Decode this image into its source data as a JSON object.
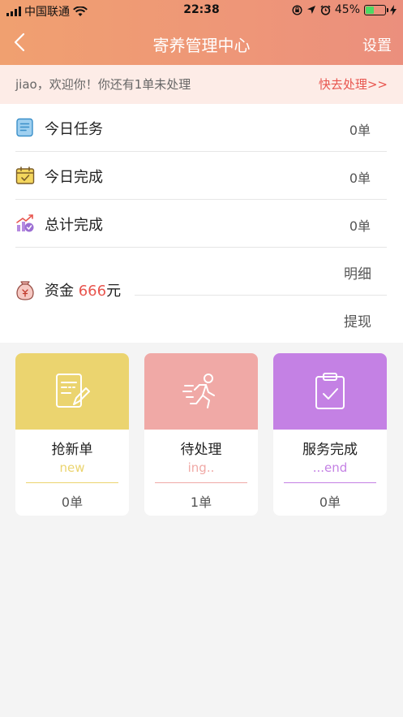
{
  "status_bar": {
    "carrier": "中国联通",
    "time": "22:38",
    "battery_percent": "45%"
  },
  "nav": {
    "title": "寄养管理中心",
    "settings_label": "设置"
  },
  "notice": {
    "message": "jiao，欢迎你！你还有1单未处理",
    "action_label": "快去处理>>"
  },
  "stats": [
    {
      "label": "今日任务",
      "count": "0单",
      "icon": "document-list-icon"
    },
    {
      "label": "今日完成",
      "count": "0单",
      "icon": "calendar-check-icon"
    },
    {
      "label": "总计完成",
      "count": "0单",
      "icon": "growth-chart-icon"
    }
  ],
  "funds": {
    "label": "资金",
    "amount": "666",
    "unit": "元",
    "detail_label": "明细",
    "withdraw_label": "提现",
    "icon": "money-bag-icon"
  },
  "cards": [
    {
      "title": "抢新单",
      "subtitle": "new",
      "count": "0单",
      "color": "#ebd46f",
      "accent": "#ebd46f",
      "icon": "edit-document-icon"
    },
    {
      "title": "待处理",
      "subtitle": "ing..",
      "count": "1单",
      "color": "#f0a9a6",
      "accent": "#f0a9a6",
      "icon": "running-person-icon"
    },
    {
      "title": "服务完成",
      "subtitle": "...end",
      "count": "0单",
      "color": "#c481e4",
      "accent": "#c481e4",
      "icon": "clipboard-check-icon"
    }
  ],
  "colors": {
    "header_start": "#f0a070",
    "header_end": "#eb8f7d",
    "notice_bg": "#fdece7",
    "highlight": "#e8554e"
  }
}
